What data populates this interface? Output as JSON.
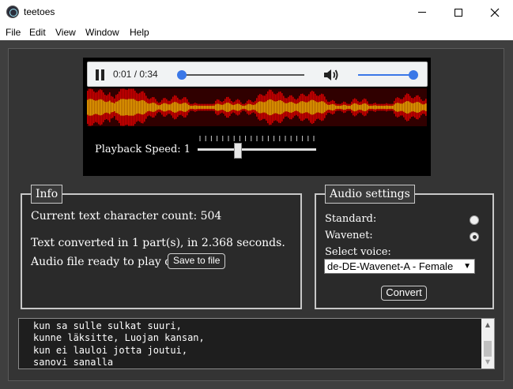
{
  "window": {
    "title": "teetoes"
  },
  "menu": {
    "items": [
      "File",
      "Edit",
      "View",
      "Window",
      "Help"
    ]
  },
  "player": {
    "time": "0:01 / 0:34",
    "progress": 0.03,
    "volume": 1.0
  },
  "playback": {
    "speed_label": "Playback Speed: 1",
    "speed_position": 0.34
  },
  "info": {
    "legend": "Info",
    "char_count": "Current text character count: 504",
    "converted": "Text converted in 1 part(s), in 2.368 seconds.",
    "ready": "Audio file ready to play or",
    "save_label": "Save to file"
  },
  "audio_settings": {
    "legend": "Audio settings",
    "standard_label": "Standard:",
    "wavenet_label": "Wavenet:",
    "selected": "wavenet",
    "voice_label": "Select voice:",
    "voice_value": "de-DE-Wavenet-A - Female",
    "convert_label": "Convert"
  },
  "text": {
    "lines": [
      "kun sa sulle sulkat suuri,",
      "kunne läksitte, Luojan kansan,",
      "kun ei lauloi jotta joutui,",
      "sanovi sanalla"
    ]
  },
  "colors": {
    "accent": "#3b78e7",
    "wave_outer": "#cc0000",
    "wave_inner": "#e8a000"
  }
}
